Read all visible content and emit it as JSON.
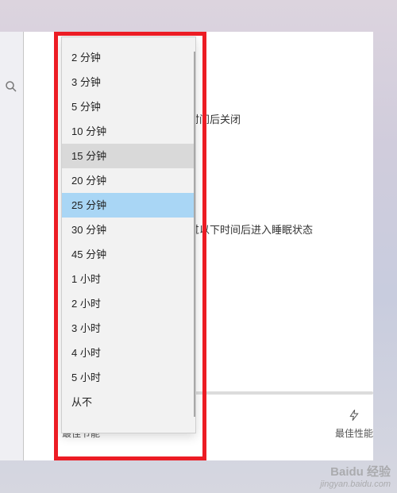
{
  "dropdown": {
    "options": [
      "2 分钟",
      "3 分钟",
      "5 分钟",
      "10 分钟",
      "15 分钟",
      "20 分钟",
      "25 分钟",
      "30 分钟",
      "45 分钟",
      "1 小时",
      "2 小时",
      "3 小时",
      "4 小时",
      "5 小时",
      "从不"
    ],
    "selected_index": 6,
    "hovered_index": 4
  },
  "settings": {
    "screen_off_label_suffix": "下时间后关闭",
    "sleep_label_suffix": "经过以下时间后进入睡眠状态"
  },
  "slider": {
    "left_label": "最佳节能",
    "right_label": "最佳性能",
    "percent": 35
  },
  "icons": {
    "search": "search-icon",
    "leaf": "leaf-icon",
    "bolt": "bolt-icon"
  },
  "watermark": {
    "brand": "Baidu 经验",
    "url": "jingyan.baidu.com"
  }
}
